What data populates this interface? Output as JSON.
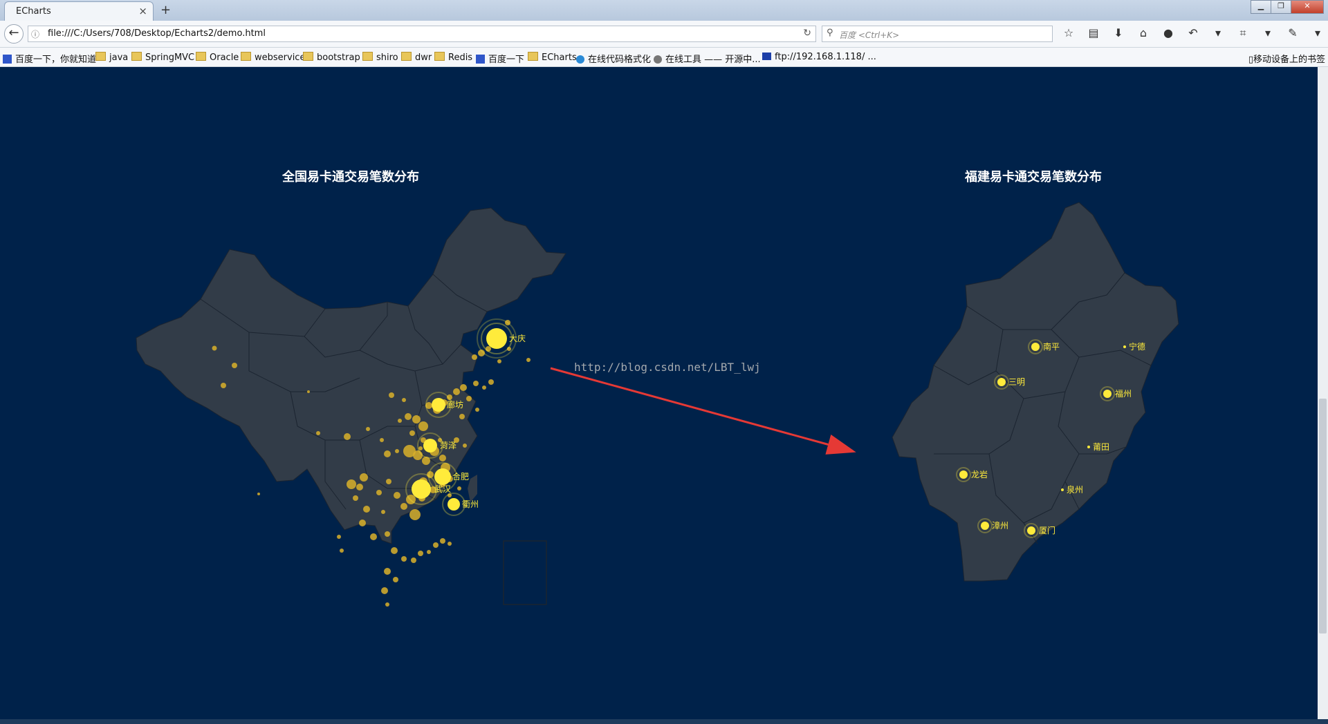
{
  "browser": {
    "tab_title": "ECharts",
    "tab_close": "×",
    "new_tab": "+",
    "url": "file:///C:/Users/708/Desktop/Echarts2/demo.html",
    "search_placeholder": "百度 <Ctrl+K>",
    "window_controls": [
      "▁",
      "❐",
      "✕"
    ]
  },
  "bookmarks": [
    {
      "label": "百度一下，你就知道",
      "icon": "baidu-icon"
    },
    {
      "label": "java",
      "icon": "folder-icon"
    },
    {
      "label": "SpringMVC",
      "icon": "folder-icon"
    },
    {
      "label": "Oracle",
      "icon": "folder-icon"
    },
    {
      "label": "webservice",
      "icon": "folder-icon"
    },
    {
      "label": "bootstrap",
      "icon": "folder-icon"
    },
    {
      "label": "shiro",
      "icon": "folder-icon"
    },
    {
      "label": "dwr",
      "icon": "folder-icon"
    },
    {
      "label": "Redis",
      "icon": "folder-icon"
    },
    {
      "label": "百度一下",
      "icon": "baidu-icon"
    },
    {
      "label": "ECharts",
      "icon": "folder-icon"
    },
    {
      "label": "在线代码格式化",
      "icon": "globe-icon"
    },
    {
      "label": "在线工具 —— 开源中...",
      "icon": "globe-icon"
    },
    {
      "label": "ftp://192.168.1.118/ ...",
      "icon": "monitor-icon"
    }
  ],
  "bookmarks_mobile": "移动设备上的书签",
  "content": {
    "left_title": "全国易卡通交易笔数分布",
    "right_title": "福建易卡通交易笔数分布",
    "watermark": "http://blog.csdn.net/LBT_lwj",
    "china_cities": [
      {
        "name": "大庆"
      },
      {
        "name": "廊坊"
      },
      {
        "name": "菏泽"
      },
      {
        "name": "合肥"
      },
      {
        "name": "武汉"
      },
      {
        "name": "衢州"
      }
    ],
    "fujian_cities": [
      {
        "name": "南平"
      },
      {
        "name": "宁德"
      },
      {
        "name": "三明"
      },
      {
        "name": "福州"
      },
      {
        "name": "莆田"
      },
      {
        "name": "龙岩"
      },
      {
        "name": "泉州"
      },
      {
        "name": "漳州"
      },
      {
        "name": "厦门"
      }
    ]
  },
  "colors": {
    "background": "#00224a",
    "land": "#323c48",
    "point": "#ffeb3b",
    "arrow": "#e53935"
  }
}
